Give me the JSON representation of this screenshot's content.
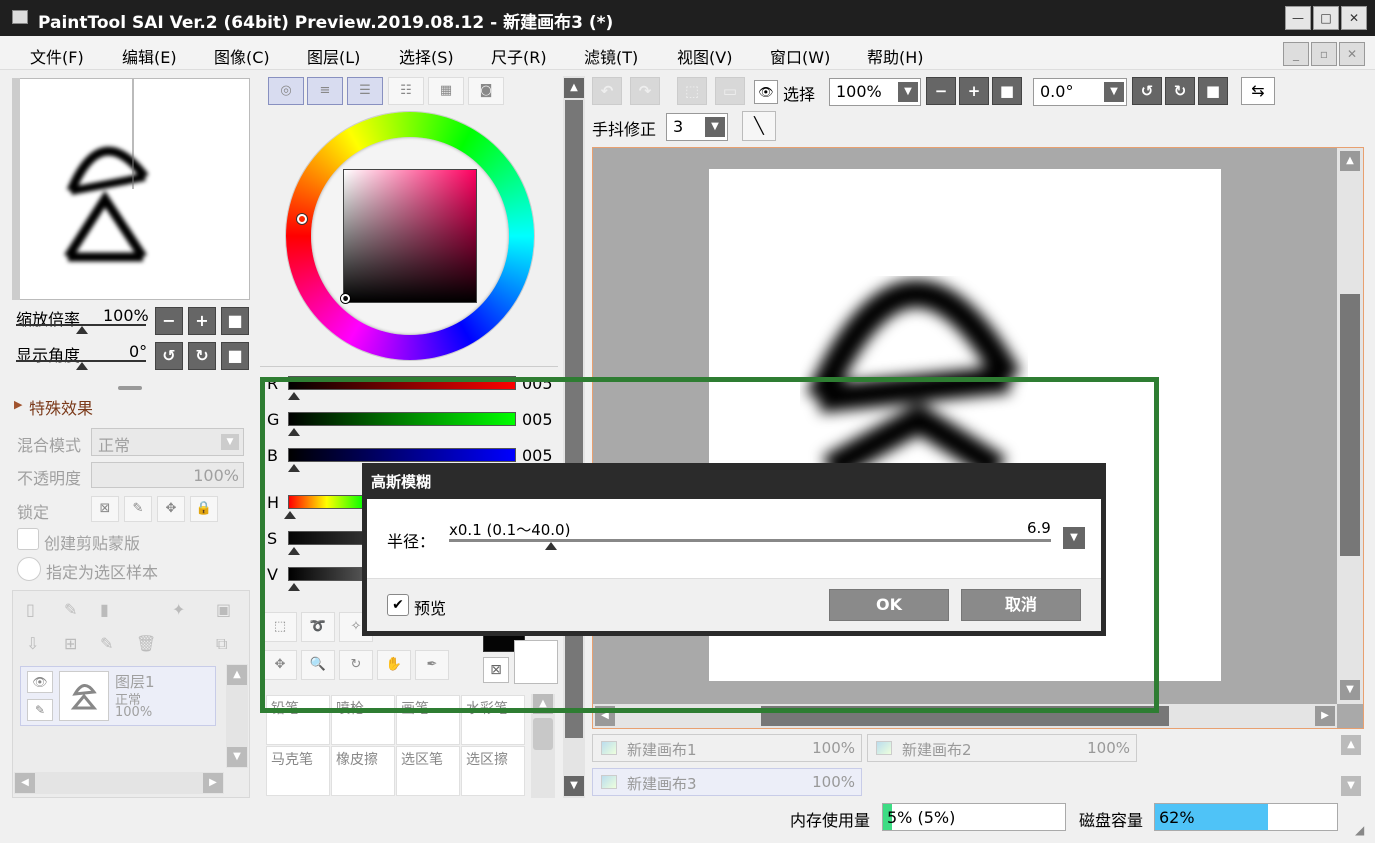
{
  "window": {
    "title": "PaintTool SAI Ver.2 (64bit) Preview.2019.08.12 - 新建画布3 (*)"
  },
  "menu": [
    "文件(F)",
    "编辑(E)",
    "图像(C)",
    "图层(L)",
    "选择(S)",
    "尺子(R)",
    "滤镜(T)",
    "视图(V)",
    "窗口(W)",
    "帮助(H)"
  ],
  "navigator": {
    "zoom_label": "缩放倍率",
    "zoom_value": "100%",
    "angle_label": "显示角度",
    "angle_value": "0°"
  },
  "layer_panel": {
    "effects_label": "特殊效果",
    "blend_label": "混合模式",
    "blend_value": "正常",
    "opacity_label": "不透明度",
    "opacity_value": "100%",
    "lock_label": "锁定",
    "clip_label": "创建剪贴蒙版",
    "sample_label": "指定为选区样本",
    "layer": {
      "name": "图层1",
      "mode": "正常",
      "opacity": "100%"
    }
  },
  "color": {
    "r_label": "R",
    "r_value": "005",
    "g_label": "G",
    "g_value": "005",
    "b_label": "B",
    "b_value": "005",
    "h_label": "H",
    "s_label": "S",
    "v_label": "V"
  },
  "brushes": [
    {
      "name": "铅笔"
    },
    {
      "name": "喷枪"
    },
    {
      "name": "画笔"
    },
    {
      "name": "水彩笔"
    },
    {
      "name": "马克笔"
    },
    {
      "name": "橡皮擦"
    },
    {
      "name": "选区笔"
    },
    {
      "name": "选区擦"
    }
  ],
  "toolbar": {
    "select_label": "选择",
    "zoom_value": "100%",
    "angle_value": "0.0°",
    "stabilizer_label": "手抖修正",
    "stabilizer_value": "3"
  },
  "canvas_tabs": [
    {
      "name": "新建画布1",
      "zoom": "100%"
    },
    {
      "name": "新建画布2",
      "zoom": "100%"
    },
    {
      "name": "新建画布3",
      "zoom": "100%"
    }
  ],
  "status": {
    "memory_label": "内存使用量",
    "memory_value": "5% (5%)",
    "memory_fill": 0.05,
    "disk_label": "磁盘容量",
    "disk_value": "62%",
    "disk_fill": 0.62
  },
  "dialog": {
    "title": "高斯模糊",
    "radius_label": "半径：",
    "radius_range": "x0.1 (0.1～40.0)",
    "radius_value": "6.9",
    "preview_label": "预览",
    "ok_label": "OK",
    "cancel_label": "取消"
  },
  "colors": {
    "highlight_box": "#2e7d32",
    "accent_orange": "#e8a070",
    "memory_bar": "#3ddc84",
    "disk_bar": "#4fc3f7"
  }
}
